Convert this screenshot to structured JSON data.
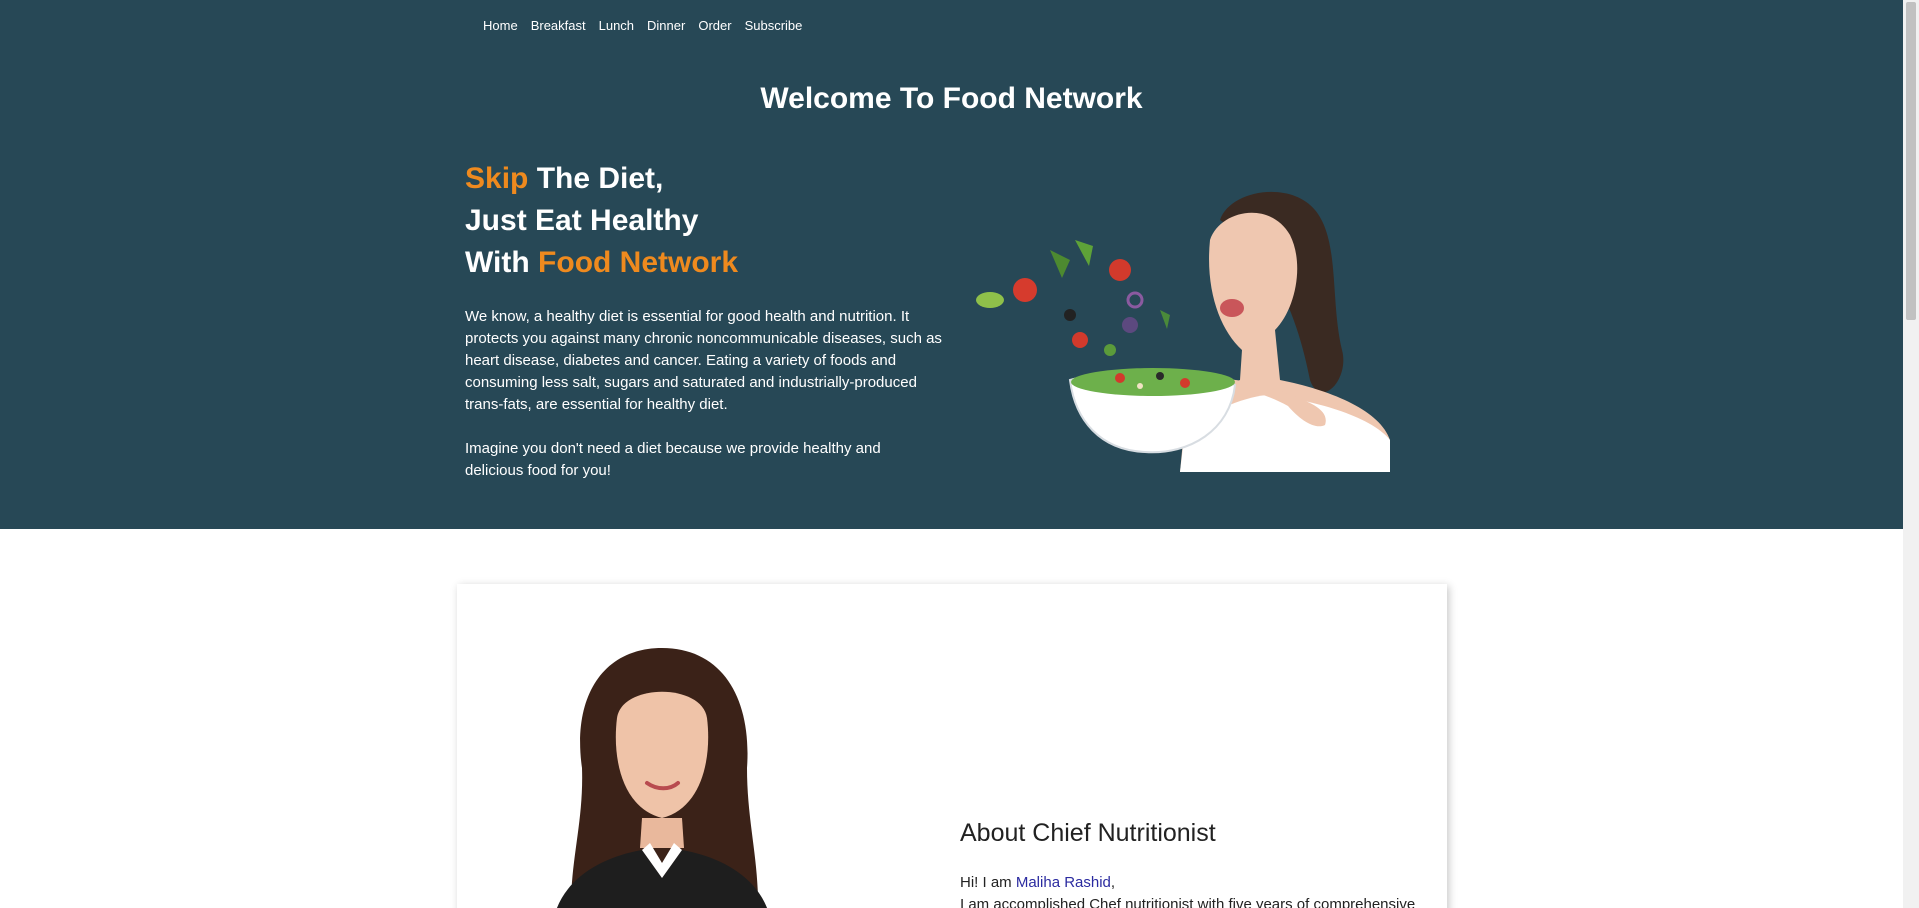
{
  "nav": {
    "items": [
      {
        "label": "Home"
      },
      {
        "label": "Breakfast"
      },
      {
        "label": "Lunch"
      },
      {
        "label": "Dinner"
      },
      {
        "label": "Order"
      },
      {
        "label": "Subscribe"
      }
    ]
  },
  "hero": {
    "title": "Welcome To Food Network",
    "headline": {
      "line1_accent": "Skip",
      "line1_rest": " The Diet,",
      "line2": "Just Eat Healthy",
      "line3_start": "With ",
      "line3_accent": "Food Network"
    },
    "paragraph1": "We know, a healthy diet is essential for good health and nutrition. It protects you against many chronic noncommunicable diseases, such as heart disease, diabetes and cancer. Eating a variety of foods and consuming less salt, sugars and saturated and industrially-produced trans-fats, are essential for healthy diet.",
    "paragraph2": "Imagine you don't need a diet because we provide healthy and delicious food for you!"
  },
  "about": {
    "title": "About Chief Nutritionist",
    "greeting_prefix": "Hi! I am ",
    "name": "Maliha Rashid",
    "greeting_suffix": ",",
    "intro": "I am accomplished Chef nutritionist with five years of comprehensive"
  },
  "colors": {
    "hero_bg": "#274856",
    "accent": "#ef8a1e",
    "name_link": "#2b2ba0"
  }
}
